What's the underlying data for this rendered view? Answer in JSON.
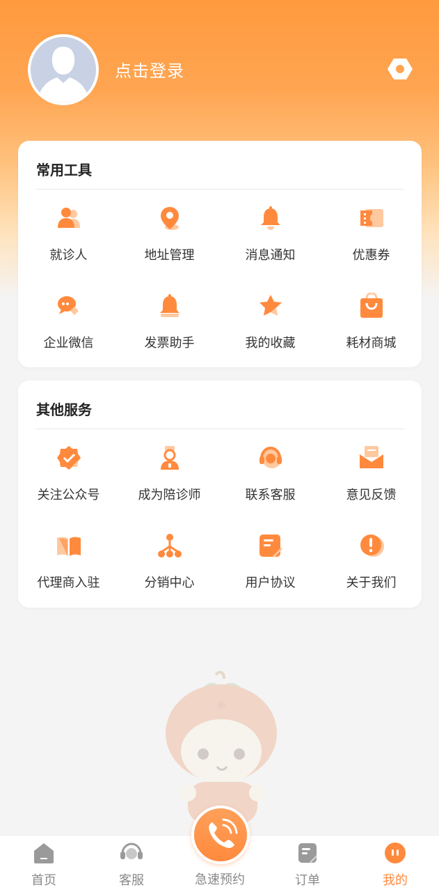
{
  "header": {
    "login_text": "点击登录",
    "settings_icon": "settings-hexagon-icon"
  },
  "tools": {
    "title": "常用工具",
    "items": [
      {
        "label": "就诊人",
        "icon": "patient-icon"
      },
      {
        "label": "地址管理",
        "icon": "location-pin-icon"
      },
      {
        "label": "消息通知",
        "icon": "bell-icon"
      },
      {
        "label": "优惠券",
        "icon": "coupon-icon"
      },
      {
        "label": "企业微信",
        "icon": "chat-icon"
      },
      {
        "label": "发票助手",
        "icon": "invoice-bell-icon"
      },
      {
        "label": "我的收藏",
        "icon": "star-icon"
      },
      {
        "label": "耗材商城",
        "icon": "shopping-bag-icon"
      }
    ]
  },
  "services": {
    "title": "其他服务",
    "items": [
      {
        "label": "关注公众号",
        "icon": "verified-badge-icon"
      },
      {
        "label": "成为陪诊师",
        "icon": "nurse-icon"
      },
      {
        "label": "联系客服",
        "icon": "headset-icon"
      },
      {
        "label": "意见反馈",
        "icon": "mail-icon"
      },
      {
        "label": "代理商入驻",
        "icon": "book-icon"
      },
      {
        "label": "分销中心",
        "icon": "hierarchy-icon"
      },
      {
        "label": "用户协议",
        "icon": "document-icon"
      },
      {
        "label": "关于我们",
        "icon": "info-exclamation-icon"
      }
    ]
  },
  "tabbar": {
    "home": "首页",
    "service": "客服",
    "book": "急速预约",
    "orders": "订单",
    "mine": "我的"
  },
  "colors": {
    "accent": "#ff8a3d",
    "icon_light": "#ffc9a0",
    "tab_inactive": "#8a8a8a"
  }
}
